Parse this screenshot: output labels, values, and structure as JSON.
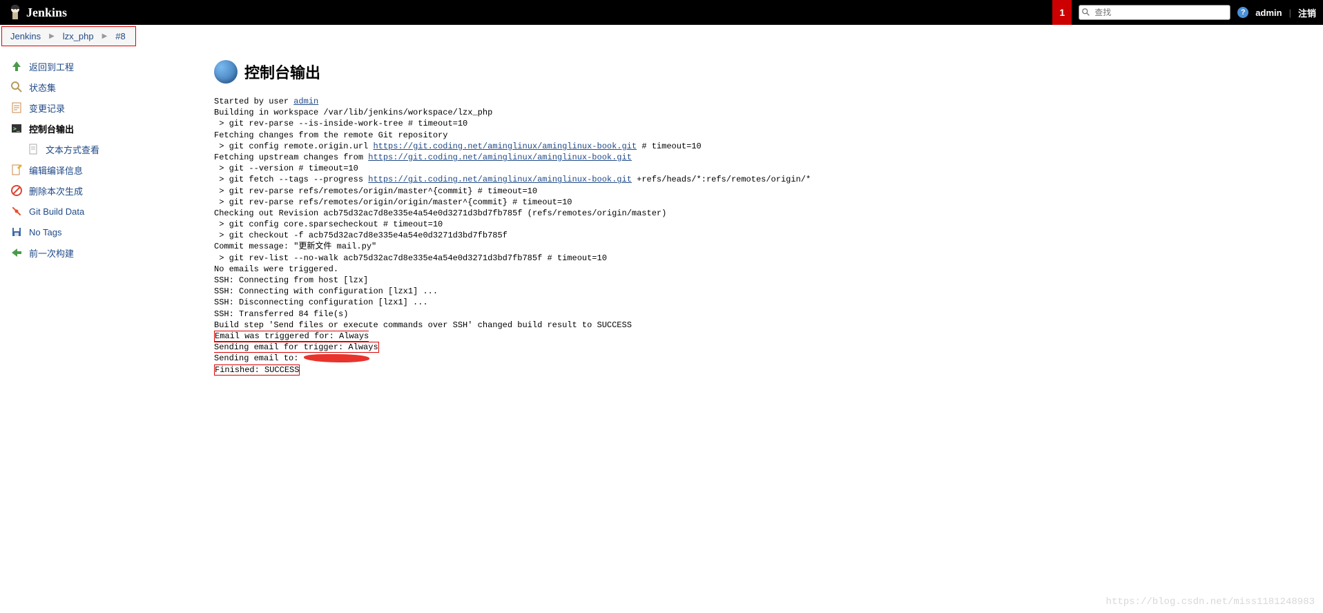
{
  "header": {
    "logo": "Jenkins",
    "notif_count": "1",
    "search_placeholder": "查找",
    "help_tip": "?",
    "user": "admin",
    "logout": "注销"
  },
  "breadcrumb": {
    "items": [
      "Jenkins",
      "lzx_php",
      "#8"
    ]
  },
  "sidebar": {
    "items": [
      {
        "label": "返回到工程",
        "icon": "up-arrow"
      },
      {
        "label": "状态集",
        "icon": "magnify"
      },
      {
        "label": "变更记录",
        "icon": "doc"
      },
      {
        "label": "控制台输出",
        "icon": "terminal",
        "bold": true
      },
      {
        "label": "文本方式查看",
        "icon": "page",
        "sub": true
      },
      {
        "label": "编辑编译信息",
        "icon": "doc-edit"
      },
      {
        "label": "删除本次生成",
        "icon": "forbidden"
      },
      {
        "label": "Git Build Data",
        "icon": "git"
      },
      {
        "label": "No Tags",
        "icon": "save"
      },
      {
        "label": "前一次构建",
        "icon": "left-arrow"
      }
    ]
  },
  "page": {
    "title": "控制台输出"
  },
  "console": {
    "started_by_prefix": "Started by user ",
    "started_by_user": "admin",
    "lines1": "Building in workspace /var/lib/jenkins/workspace/lzx_php\n > git rev-parse --is-inside-work-tree # timeout=10\nFetching changes from the remote Git repository\n > git config remote.origin.url ",
    "git_url": "https://git.coding.net/aminglinux/aminglinux-book.git",
    "lines2": " # timeout=10\nFetching upstream changes from ",
    "lines3": "\n > git --version # timeout=10\n > git fetch --tags --progress ",
    "lines4": " +refs/heads/*:refs/remotes/origin/*\n > git rev-parse refs/remotes/origin/master^{commit} # timeout=10\n > git rev-parse refs/remotes/origin/origin/master^{commit} # timeout=10\nChecking out Revision acb75d32ac7d8e335e4a54e0d3271d3bd7fb785f (refs/remotes/origin/master)\n > git config core.sparsecheckout # timeout=10\n > git checkout -f acb75d32ac7d8e335e4a54e0d3271d3bd7fb785f\nCommit message: \"更新文件 mail.py\"\n > git rev-list --no-walk acb75d32ac7d8e335e4a54e0d3271d3bd7fb785f # timeout=10\nNo emails were triggered.\nSSH: Connecting from host [lzx]\nSSH: Connecting with configuration [lzx1] ...\nSSH: Disconnecting configuration [lzx1] ...\nSSH: Transferred 84 file(s)\nBuild step 'Send files or execute commands over SSH' changed build result to SUCCESS",
    "email_triggered": "Email was triggered for: Always\nSending email for trigger: Always",
    "sending_to": "Sending email to: ",
    "finished": "Finished: SUCCESS"
  },
  "watermark": "https://blog.csdn.net/miss1181248983"
}
